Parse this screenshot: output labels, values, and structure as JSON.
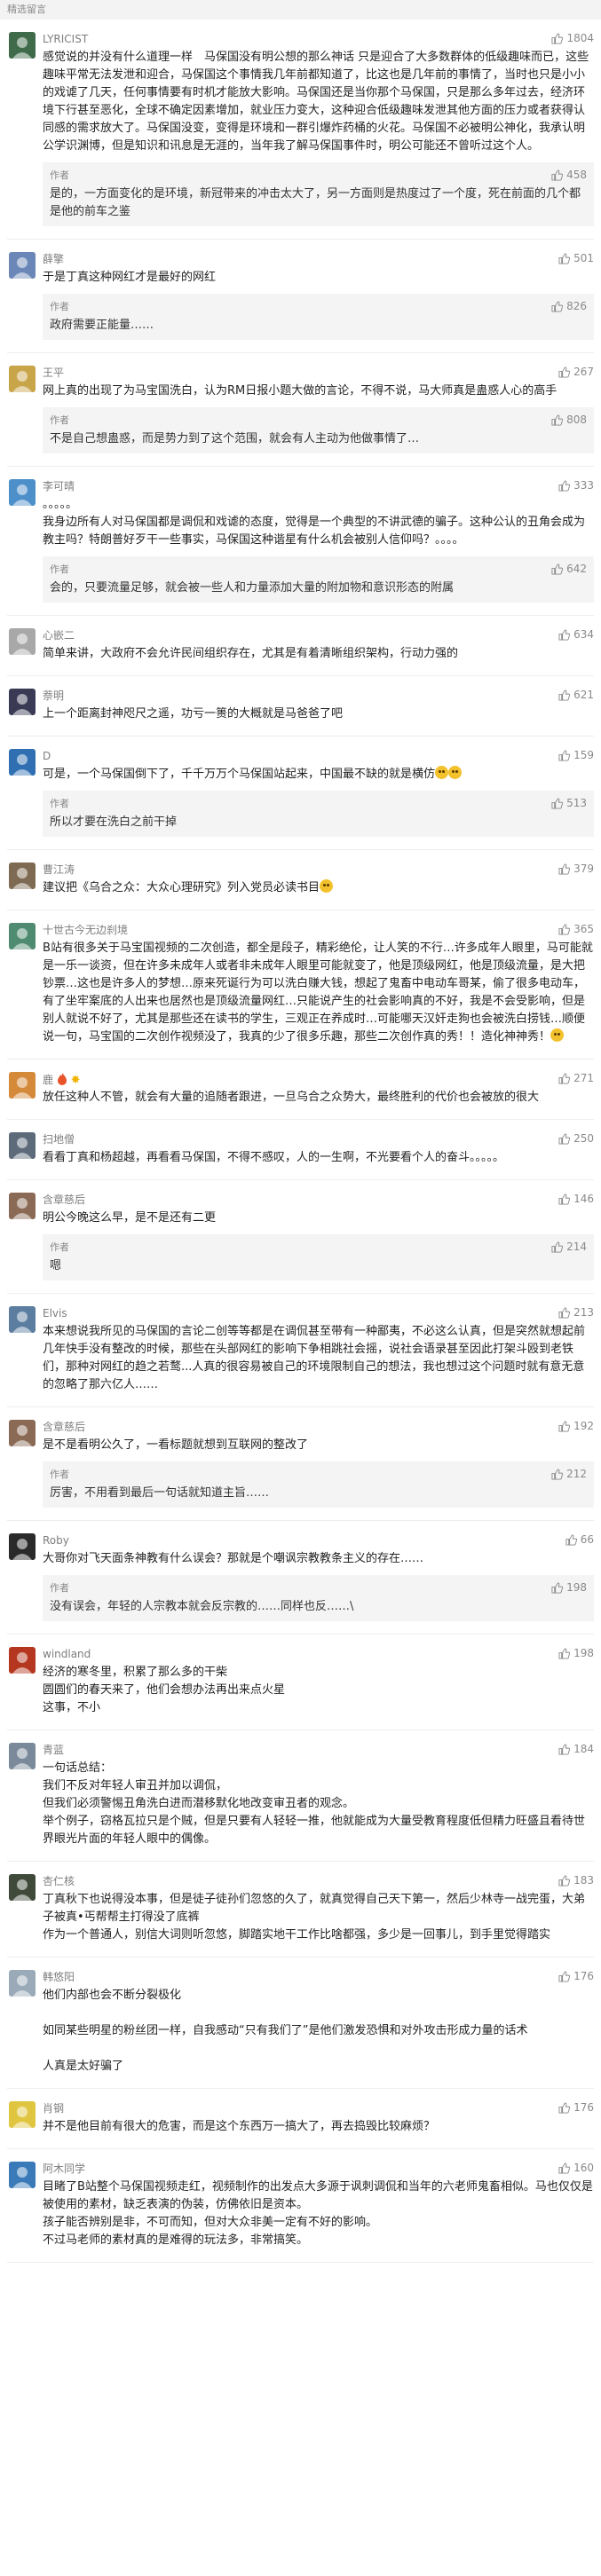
{
  "header": {
    "title": "精选留言"
  },
  "comments": [
    {
      "name": "LYRICIST",
      "likes": "1804",
      "avatar": "#3f6b4a",
      "text": "感觉说的并没有什么道理一样　马保国没有明公想的那么神话 只是迎合了大多数群体的低级趣味而已，这些趣味平常无法发泄和迎合，马保国这个事情我几年前都知道了，比这也是几年前的事情了，当时也只是小小的戏谑了几天，任何事情要有时机才能放大影响。马保国还是当你那个马保国，只是那么多年过去，经济环境下行甚至恶化，全球不确定因素增加，就业压力变大，这种迎合低级趣味发泄其他方面的压力或者获得认同感的需求放大了。马保国没变，变得是环境和一群引爆炸药桶的火花。马保国不必被明公神化，我承认明公学识渊博，但是知识和讯息是无涯的，当年我了解马保国事件时，明公可能还不曾听过这个人。",
      "reply": {
        "tag": "作者",
        "likes": "458",
        "text": "是的，一方面变化的是环境，新冠带来的冲击太大了，另一方面则是热度过了一个度，死在前面的几个都是他的前车之鉴"
      }
    },
    {
      "name": "薛擎",
      "likes": "501",
      "avatar": "#6a87b7",
      "text": "于是丁真这种网红才是最好的网红",
      "reply": {
        "tag": "作者",
        "likes": "826",
        "text": "政府需要正能量……"
      }
    },
    {
      "name": "王平",
      "likes": "267",
      "avatar": "#c9a54a",
      "text": "网上真的出现了为马宝国洗白，认为RM日报小题大做的言论，不得不说，马大师真是蛊惑人心的高手",
      "reply": {
        "tag": "作者",
        "likes": "808",
        "text": "不是自己想蛊惑，而是势力到了这个范围，就会有人主动为他做事情了…"
      }
    },
    {
      "name": "李可晴",
      "likes": "333",
      "avatar": "#4d8fc9",
      "text": "。。。。。\n我身边所有人对马保国都是调侃和戏谑的态度，觉得是一个典型的不讲武德的骗子。这种公认的丑角会成为教主吗？特朗普好歹干一些事实，马保国这种谐星有什么机会被别人信仰吗？。。。。",
      "reply": {
        "tag": "作者",
        "likes": "642",
        "text": "会的，只要流量足够，就会被一些人和力量添加大量的附加物和意识形态的附属"
      }
    },
    {
      "name": "心嵌二",
      "likes": "634",
      "avatar": "#a8a8a8",
      "text": "简单来讲，大政府不会允许民间组织存在，尤其是有着清晰组织架构，行动力强的"
    },
    {
      "name": "萘明",
      "likes": "621",
      "avatar": "#3a3a55",
      "text": "上一个距离封神咫尺之遥，功亏一篑的大概就是马爸爸了吧"
    },
    {
      "name": "D",
      "likes": "159",
      "avatar": "#2f6fb2",
      "text": "可是，一个马保国倒下了，千千万万个马保国站起来，中国最不缺的就是横仿",
      "text_emoji": "2",
      "reply": {
        "tag": "作者",
        "likes": "513",
        "text": "所以才要在洗白之前干掉"
      }
    },
    {
      "name": "曹江涛",
      "likes": "379",
      "avatar": "#7e6a52",
      "text": "建议把《乌合之众：大众心理研究》列入党员必读书目",
      "text_emoji": "1"
    },
    {
      "name": "十世古今无边刹境",
      "likes": "365",
      "avatar": "#4f8b70",
      "text": "B站有很多关于马宝国视频的二次创造，都全是段子，精彩绝伦，让人笑的不行…许多成年人眼里，马可能就是一乐一谈资，但在许多未成年人或者非未成年人眼里可能就变了，他是顶级网红，他是顶级流量，是大把钞票…这也是许多人的梦想…原来死诞行为可以洗白赚大钱，想起了鬼畜中电动车哥某，偷了很多电动车，有了坐牢案底的人出来也居然也是顶级流量网红…只能说产生的社会影响真的不好，我是不会受影响，但是别人就说不好了，尤其是那些还在读书的学生，三观正在养成时…可能哪天汉奸走狗也会被洗白捞钱…顺便说一句，马宝国的二次创作视频没了，我真的少了很多乐趣，那些二次创作真的秀！！造化神神秀！",
      "text_emoji": "1"
    },
    {
      "name": "鹿",
      "likes": "271",
      "avatar": "#d58a3a",
      "name_extra": true,
      "text": "放任这种人不管，就会有大量的追随者跟进，一旦乌合之众势大，最终胜利的代价也会被放的很大"
    },
    {
      "name": "扫地僧",
      "likes": "250",
      "avatar": "#5d6a7a",
      "text": "看看丁真和杨超越，再看看马保国，不得不感叹，人的一生啊，不光要看个人的奋斗。。。。。"
    },
    {
      "name": "含章慈后",
      "likes": "146",
      "avatar": "#8a6a55",
      "text": "明公今晚这么早，是不是还有二更",
      "reply": {
        "tag": "作者",
        "likes": "214",
        "text": "嗯"
      }
    },
    {
      "name": "Elvis",
      "likes": "213",
      "avatar": "#5a7da0",
      "text": "本来想说我所见的马保国的言论二创等等都是在调侃甚至带有一种鄙夷，不必这么认真，但是突然就想起前几年快手没有整改的时候，那些在头部网红的影响下争相跳社会摇，说社会语录甚至因此打架斗殴到老铁们，那种对网红的趋之若鹜...人真的很容易被自己的环境限制自己的想法，我也想过这个问题时就有意无意的忽略了那六亿人……"
    },
    {
      "name": "含章慈后",
      "likes": "192",
      "avatar": "#8a6a55",
      "text": "是不是看明公久了，一看标题就想到互联网的整改了",
      "reply": {
        "tag": "作者",
        "likes": "212",
        "text": "厉害，不用看到最后一句话就知道主旨……"
      }
    },
    {
      "name": "Roby",
      "likes": "66",
      "avatar": "#2a2a2a",
      "text": "大哥你对飞天面条神教有什么误会？那就是个嘲讽宗教教条主义的存在……",
      "reply": {
        "tag": "作者",
        "likes": "198",
        "text": "没有误会，年轻的人宗教本就会反宗教的……同样也反……\\"
      }
    },
    {
      "name": "windland",
      "likes": "198",
      "avatar": "#b5371f",
      "text": "经济的寒冬里，积累了那么多的干柴\n圆圆们的春天来了，他们会想办法再出来点火星\n这事，不小"
    },
    {
      "name": "青蓝",
      "likes": "184",
      "avatar": "#7a8a9a",
      "text": "一句话总结：\n我们不反对年轻人审丑并加以调侃，\n但我们必须警惕丑角洗白进而潜移默化地改变审丑者的观念。\n举个例子，窃格瓦拉只是个贼，但是只要有人轻轻一推，他就能成为大量受教育程度低但精力旺盛且看待世界眼光片面的年轻人眼中的偶像。"
    },
    {
      "name": "杏仁核",
      "likes": "183",
      "avatar": "#3f4a3a",
      "text": "丁真秋下也说得没本事，但是徒子徒孙们忽悠的久了，就真觉得自己天下第一，然后少林寺一战完蛋，大弟子被真•丐帮帮主打得没了底裤\n作为一个普通人，别信大词则听忽悠，脚踏实地干工作比啥都强，多少是一回事儿，到手里觉得踏实"
    },
    {
      "name": "韩悠阳",
      "likes": "176",
      "avatar": "#9aaab8",
      "text": "他们内部也会不断分裂极化\n\n如同某些明星的粉丝团一样，自我感动“只有我们了”是他们激发恐惧和对外攻击形成力量的话术\n\n人真是太好骗了"
    },
    {
      "name": "肖钢",
      "likes": "176",
      "avatar": "#e0c640",
      "text": "并不是他目前有很大的危害，而是这个东西万一搞大了，再去捣毁比较麻烦？"
    },
    {
      "name": "阿木同学",
      "likes": "160",
      "avatar": "#3a7ab8",
      "text": "目睹了B站整个马保国视频走红，视频制作的出发点大多源于讽刺调侃和当年的六老师鬼畜相似。马也仅仅是被使用的素材，缺乏表演的伪装，仿佛依旧是资本。\n孩子能否辨别是非，不可而知，但对大众非美一定有不好的影响。\n不过马老师的素材真的是难得的玩法多，非常搞笑。"
    }
  ]
}
